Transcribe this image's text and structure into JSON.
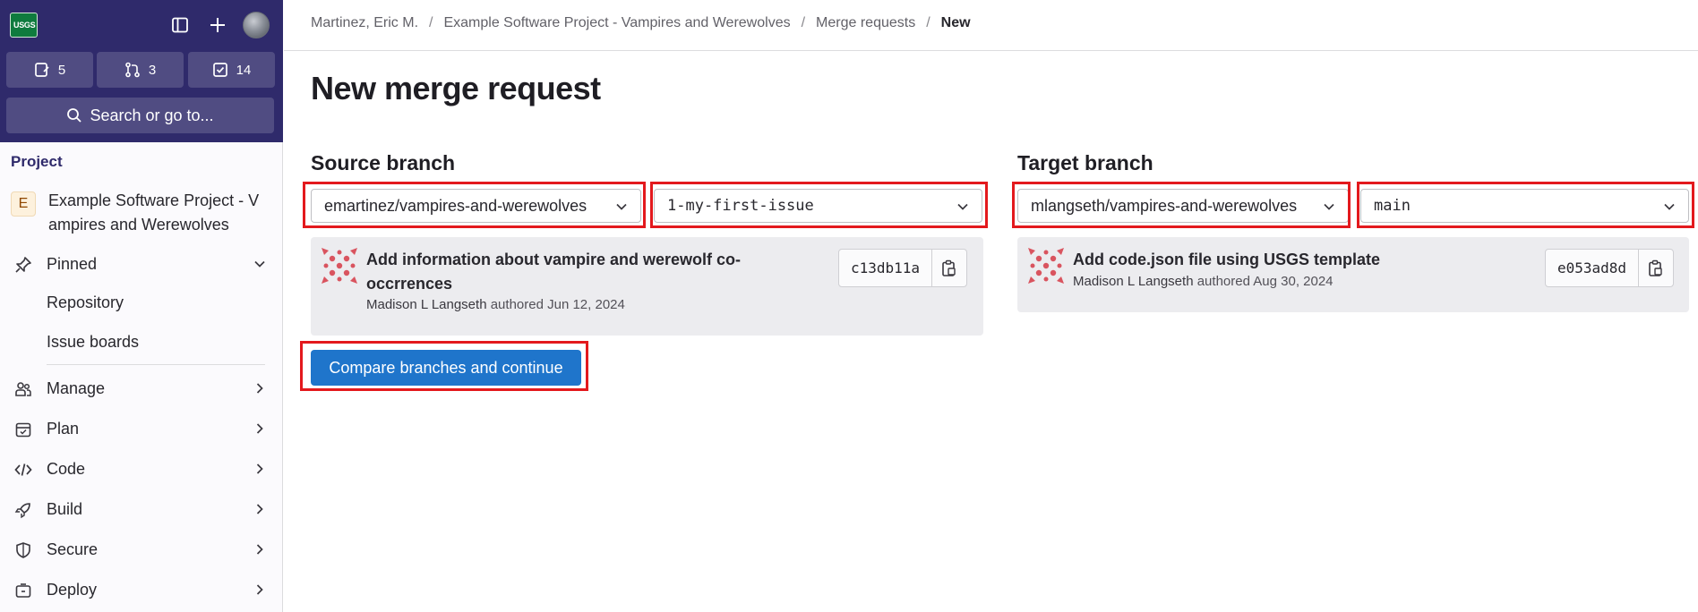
{
  "sidebar": {
    "logo_text": "USGS",
    "counters": [
      {
        "icon": "issues-icon",
        "count": "5"
      },
      {
        "icon": "merge-request-icon",
        "count": "3"
      },
      {
        "icon": "todo-icon",
        "count": "14"
      }
    ],
    "search_label": "Search or go to...",
    "section_label": "Project",
    "project_avatar": "E",
    "project_name": "Example Software Project - V ampires and Werewolves",
    "pinned_label": "Pinned",
    "pinned_items": [
      "Repository",
      "Issue boards"
    ],
    "nav": [
      {
        "label": "Manage",
        "icon": "users-icon"
      },
      {
        "label": "Plan",
        "icon": "calendar-icon"
      },
      {
        "label": "Code",
        "icon": "code-icon"
      },
      {
        "label": "Build",
        "icon": "rocket-icon"
      },
      {
        "label": "Secure",
        "icon": "shield-icon"
      },
      {
        "label": "Deploy",
        "icon": "deploy-icon"
      }
    ]
  },
  "breadcrumb": [
    "Martinez, Eric M.",
    "Example Software Project - Vampires and Werewolves",
    "Merge requests",
    "New"
  ],
  "page_title": "New merge request",
  "source": {
    "title": "Source branch",
    "project": "emartinez/vampires-and-werewolves",
    "branch": "1-my-first-issue",
    "commit": {
      "title_line1": "Add information about vampire and werewolf co-",
      "title_line2": "occrrences",
      "author": "Madison L Langseth",
      "authored": "authored Jun 12, 2024",
      "sha": "c13db11a"
    }
  },
  "target": {
    "title": "Target branch",
    "project": "mlangseth/vampires-and-werewolves",
    "branch": "main",
    "commit": {
      "title_line1": "Add code.json file using USGS template",
      "author": "Madison L Langseth",
      "authored": "authored Aug 30, 2024",
      "sha": "e053ad8d"
    }
  },
  "compare_button": "Compare branches and continue",
  "colors": {
    "sidebar_top": "#2f2a6b",
    "primary": "#1f75cb",
    "highlight": "#e3191d"
  }
}
